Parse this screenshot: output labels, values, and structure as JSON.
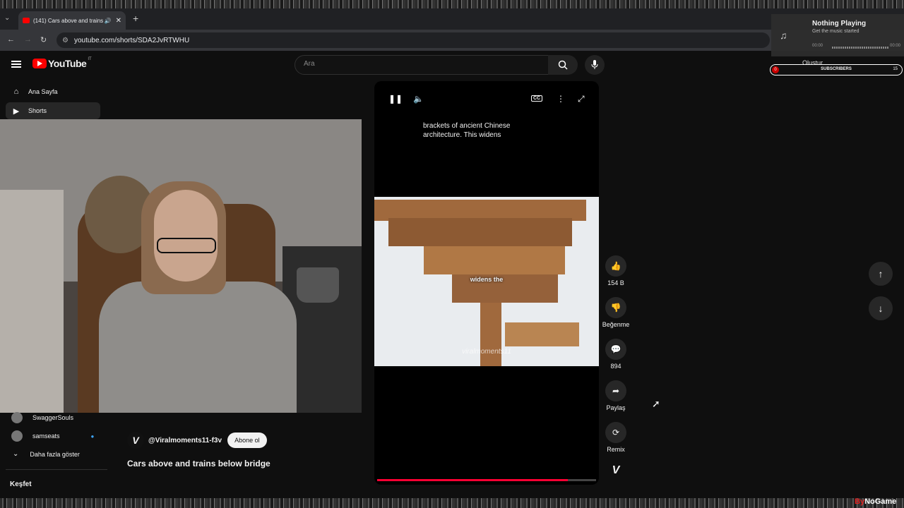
{
  "browser": {
    "tab_title": "(141) Cars above and trains",
    "url": "youtube.com/shorts/SDA2JvRTWHU"
  },
  "youtube": {
    "logo_text": "YouTube",
    "logo_region": "IT",
    "search_placeholder": "Ara",
    "sidebar": [
      {
        "label": "Ana Sayfa",
        "icon": "home-icon"
      },
      {
        "label": "Shorts",
        "icon": "shorts-icon"
      }
    ],
    "subscriptions": [
      {
        "label": "SwaggerSouls"
      },
      {
        "label": "samseats"
      }
    ],
    "show_more": "Daha fazla göster",
    "explore": "Keşfet"
  },
  "short": {
    "caption": "brackets of ancient Chinese architecture. This widens",
    "overlay_text": "widens the",
    "watermark": "viralmoments11",
    "channel_avatar": "V",
    "channel": "@Viralmoments11-f3v",
    "subscribe_label": "Abone ol",
    "title": "Cars above and trains below bridge",
    "progress": 0.87
  },
  "actions": {
    "likes": "154 B",
    "dislike": "Beğenme",
    "comments": "894",
    "share": "Paylaş",
    "remix": "Remix",
    "channel_badge": "V"
  },
  "overlay": {
    "np_title": "Nothing Playing",
    "np_sub": "Get the music started",
    "time_start": "00:00",
    "time_end": "00:00",
    "create": "Oluştur",
    "subs_label": "SUBSCRIBERS",
    "subs_left": "0",
    "subs_right": "15",
    "brand_a": "By",
    "brand_b": "NoGame"
  }
}
